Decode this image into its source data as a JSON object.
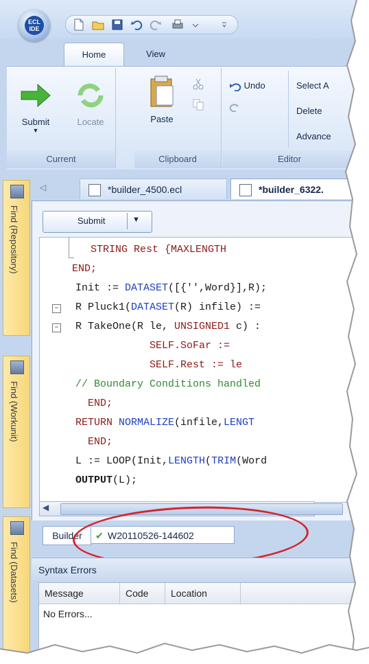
{
  "app": {
    "logo_text": "ECL IDE"
  },
  "ribbon": {
    "tabs": [
      {
        "label": "Home"
      },
      {
        "label": "View"
      }
    ],
    "groups": {
      "current": {
        "label": "Current",
        "submit": "Submit",
        "locate": "Locate"
      },
      "clipboard": {
        "label": "Clipboard",
        "paste": "Paste"
      },
      "editor": {
        "label": "Editor",
        "undo": "Undo",
        "select": "Select A",
        "delete": "Delete",
        "advanced": "Advance"
      }
    }
  },
  "sidebar": {
    "panels": [
      {
        "label": "Find (Repository)"
      },
      {
        "label": "Find (Workunit)"
      },
      {
        "label": "Find (Datasets)"
      }
    ]
  },
  "documents": {
    "tabs": [
      {
        "label": "*builder_4500.ecl"
      },
      {
        "label": "*builder_6322."
      }
    ]
  },
  "editor": {
    "submit_label": "Submit",
    "code": {
      "l1_a": "      STRING Rest {MAXLENGTH",
      "l2_a": "   END;",
      "l3_a": "Init := ",
      "l3_b": "DATASET",
      "l3_c": "([{'',Word}],R);",
      "l4_a": "R Pluck1(",
      "l4_b": "DATASET",
      "l4_c": "(R) infile) :=",
      "l5_a": "R TakeOne(R le, ",
      "l5_b": "UNSIGNED1",
      "l5_c": " c) :",
      "l6_a": "            SELF.SoFar :=",
      "l7_a": "            SELF.Rest := le",
      "l8_a": "// Boundary Conditions handled",
      "l9_a": "  END;",
      "l10_a": "RETURN ",
      "l10_b": "NORMALIZE",
      "l10_c": "(infile,",
      "l10_d": "LENGT",
      "l11_a": "  END;",
      "l12_a": "L := LOOP(Init,",
      "l12_b": "LENGTH",
      "l12_c": "(",
      "l12_d": "TRIM",
      "l12_e": "(Word",
      "l13_a": "OUTPUT",
      "l13_b": "(L);"
    }
  },
  "builder": {
    "tab_label": "Builder",
    "workunit_label": "W20110526-144602"
  },
  "syntax_errors": {
    "title": "Syntax Errors",
    "columns": [
      "Message",
      "Code",
      "Location"
    ],
    "rows": [
      "No Errors..."
    ]
  },
  "colors": {
    "accent": "#d4252c",
    "ribbon": "#c4d6ee"
  }
}
